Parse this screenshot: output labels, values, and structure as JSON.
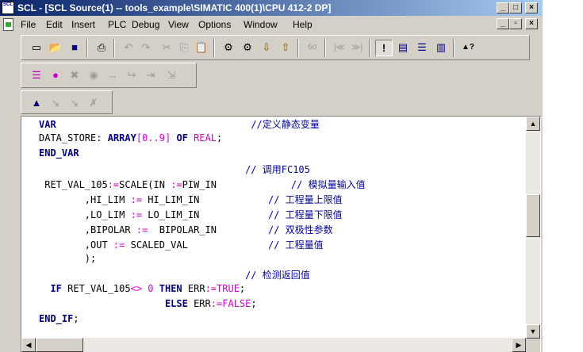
{
  "window": {
    "title": "SCL  - [SCL Source(1) -- tools_example\\SIMATIC 400(1)\\CPU 412-2 DP]",
    "app_icon_text": "SCL",
    "caption_buttons": {
      "minimize": "_",
      "maximize": "□",
      "close": "×"
    },
    "colors": {
      "title_active": "#0a246a",
      "title_gradient_end": "#a6caf0",
      "face": "#d4d0c8"
    }
  },
  "menubar": {
    "items": [
      "File",
      "Edit",
      "Insert",
      "PLC",
      "Debug",
      "View",
      "Options",
      "Window",
      "Help"
    ],
    "mdi_buttons": {
      "minimize": "_",
      "restore": "▫",
      "close": "×"
    }
  },
  "toolbar_main": {
    "buttons": [
      {
        "icon": "new-icon",
        "glyph": "▭"
      },
      {
        "icon": "open-icon",
        "glyph": "📂"
      },
      {
        "icon": "save-icon",
        "glyph": "■"
      },
      {
        "icon": "print-icon",
        "glyph": "⎙"
      },
      {
        "icon": "undo-icon",
        "glyph": "↶"
      },
      {
        "icon": "redo-icon",
        "glyph": "↷"
      },
      {
        "icon": "cut-icon",
        "glyph": "✂"
      },
      {
        "icon": "copy-icon",
        "glyph": "⎘"
      },
      {
        "icon": "paste-icon",
        "glyph": "📋"
      },
      {
        "icon": "compile-icon",
        "glyph": "⚙"
      },
      {
        "icon": "compile-all-icon",
        "glyph": "⚙"
      },
      {
        "icon": "download-icon",
        "glyph": "⇩"
      },
      {
        "icon": "upload-icon",
        "glyph": "⇧"
      },
      {
        "icon": "monitor-icon",
        "glyph": "6σ"
      },
      {
        "icon": "prev-error-icon",
        "glyph": "|≪"
      },
      {
        "icon": "next-error-icon",
        "glyph": "≫|"
      },
      {
        "icon": "info-icon",
        "glyph": "!"
      },
      {
        "icon": "cascade-icon",
        "glyph": "▤"
      },
      {
        "icon": "tile-horizontal-icon",
        "glyph": "☰"
      },
      {
        "icon": "tile-vertical-icon",
        "glyph": "▥"
      },
      {
        "icon": "context-help-icon",
        "glyph": "▲?"
      }
    ]
  },
  "toolbar_debug": {
    "buttons": [
      {
        "icon": "list-icon",
        "glyph": "☰"
      },
      {
        "icon": "breakpoint-icon",
        "glyph": "●"
      },
      {
        "icon": "delete-breakpoint-icon",
        "glyph": "✖"
      },
      {
        "icon": "breakpoint-toggle-icon",
        "glyph": "◉"
      },
      {
        "icon": "step-into-icon",
        "glyph": "→"
      },
      {
        "icon": "step-over-icon",
        "glyph": "↪"
      },
      {
        "icon": "step-out-icon",
        "glyph": "⇥"
      },
      {
        "icon": "run-to-cursor-icon",
        "glyph": "⇲"
      }
    ]
  },
  "toolbar_bookmark": {
    "buttons": [
      {
        "icon": "bookmark-toggle-icon",
        "glyph": "▲"
      },
      {
        "icon": "bookmark-next-icon",
        "glyph": "↘"
      },
      {
        "icon": "bookmark-prev-icon",
        "glyph": "↘"
      },
      {
        "icon": "bookmark-clear-icon",
        "glyph": "✗"
      }
    ]
  },
  "code": {
    "lines": [
      [
        {
          "t": "VAR",
          "c": "kw"
        },
        {
          "t": "                                  //定义静态变量",
          "c": "cm"
        }
      ],
      [
        {
          "t": "DATA_STORE: ",
          "c": "tx"
        },
        {
          "t": "ARRAY",
          "c": "kw"
        },
        {
          "t": "[",
          "c": "op"
        },
        {
          "t": "0",
          "c": "op"
        },
        {
          "t": "..",
          "c": "op"
        },
        {
          "t": "9",
          "c": "op"
        },
        {
          "t": "] ",
          "c": "op"
        },
        {
          "t": "OF",
          "c": "kw"
        },
        {
          "t": " ",
          "c": "tx"
        },
        {
          "t": "REAL",
          "c": "op"
        },
        {
          "t": ";",
          "c": "tx"
        }
      ],
      [
        {
          "t": "END_VAR",
          "c": "kw"
        }
      ],
      [
        {
          "t": "                                    // 调用FC105",
          "c": "cm"
        }
      ],
      [
        {
          "t": " RET_VAL_105",
          "c": "tx"
        },
        {
          "t": ":=",
          "c": "op"
        },
        {
          "t": "SCALE(IN ",
          "c": "tx"
        },
        {
          "t": ":=",
          "c": "op"
        },
        {
          "t": "PIW_IN             ",
          "c": "tx"
        },
        {
          "t": "// 模拟量输入值",
          "c": "cm"
        }
      ],
      [
        {
          "t": "        ,HI_LIM ",
          "c": "tx"
        },
        {
          "t": ":=",
          "c": "op"
        },
        {
          "t": " HI_LIM_IN            ",
          "c": "tx"
        },
        {
          "t": "// 工程量上限值",
          "c": "cm"
        }
      ],
      [
        {
          "t": "        ,LO_LIM ",
          "c": "tx"
        },
        {
          "t": ":=",
          "c": "op"
        },
        {
          "t": " LO_LIM_IN            ",
          "c": "tx"
        },
        {
          "t": "// 工程量下限值",
          "c": "cm"
        }
      ],
      [
        {
          "t": "        ,BIPOLAR ",
          "c": "tx"
        },
        {
          "t": ":=",
          "c": "op"
        },
        {
          "t": "  BIPOLAR_IN         ",
          "c": "tx"
        },
        {
          "t": "// 双极性参数",
          "c": "cm"
        }
      ],
      [
        {
          "t": "        ,OUT ",
          "c": "tx"
        },
        {
          "t": ":=",
          "c": "op"
        },
        {
          "t": " SCALED_VAL              ",
          "c": "tx"
        },
        {
          "t": "// 工程量值",
          "c": "cm"
        }
      ],
      [
        {
          "t": "        );",
          "c": "tx"
        }
      ],
      [
        {
          "t": "                                    // 检测返回值",
          "c": "cm"
        }
      ],
      [
        {
          "t": "  ",
          "c": "tx"
        },
        {
          "t": "IF",
          "c": "kw"
        },
        {
          "t": " RET_VAL_105",
          "c": "tx"
        },
        {
          "t": "<>",
          "c": "op"
        },
        {
          "t": " 0 ",
          "c": "op"
        },
        {
          "t": "THEN",
          "c": "kw"
        },
        {
          "t": " ERR",
          "c": "tx"
        },
        {
          "t": ":=",
          "c": "op"
        },
        {
          "t": "TRUE",
          "c": "op"
        },
        {
          "t": ";",
          "c": "tx"
        }
      ],
      [
        {
          "t": "                      ",
          "c": "tx"
        },
        {
          "t": "ELSE",
          "c": "kw"
        },
        {
          "t": " ERR",
          "c": "tx"
        },
        {
          "t": ":=",
          "c": "op"
        },
        {
          "t": "FALSE",
          "c": "op"
        },
        {
          "t": ";",
          "c": "tx"
        }
      ],
      [
        {
          "t": "END_IF",
          "c": "kw"
        },
        {
          "t": ";",
          "c": "tx"
        }
      ]
    ]
  },
  "scrollbars": {
    "vertical": {
      "up": "▲",
      "down": "▼",
      "position": 0.42
    },
    "horizontal": {
      "left": "◀",
      "right": "▶",
      "position": 0.0
    }
  }
}
